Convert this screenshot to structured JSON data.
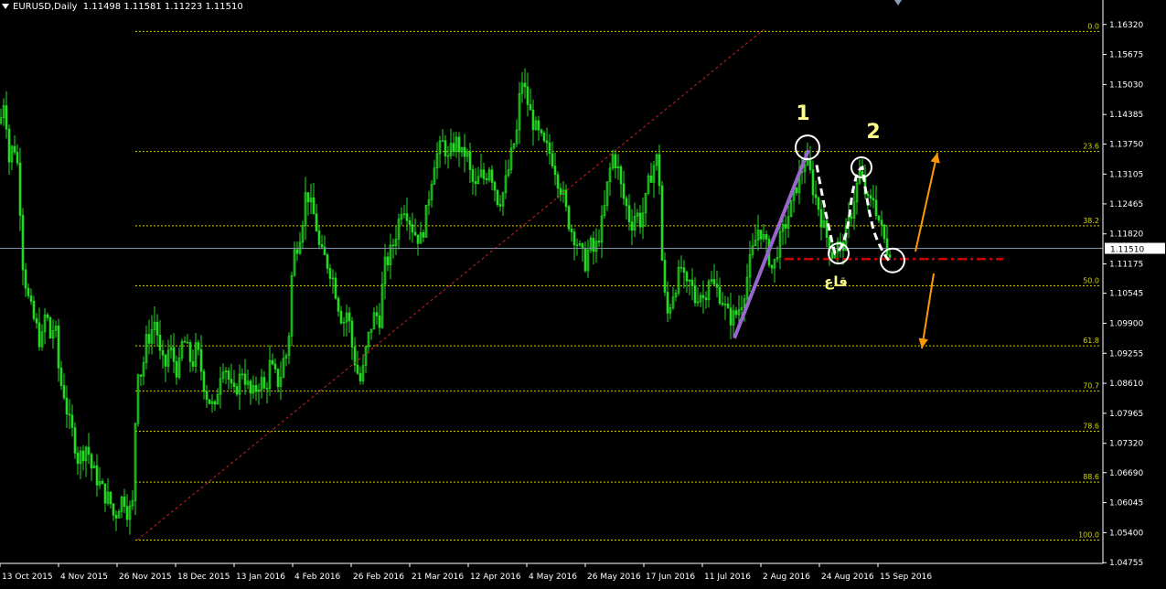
{
  "header": {
    "symbol": "EURUSD,Daily",
    "ohlc": "1.11498 1.11581 1.11223 1.11510"
  },
  "colors": {
    "background": "#000000",
    "candles": "#22dd22",
    "grid_levels": "#d4d400",
    "axis": "#ffffff",
    "trendline": "#cc2222",
    "support_line": "#cc0000",
    "impulse_line": "#9966cc",
    "arrows": "#ff9900",
    "current_price_line": "#7f8f9f"
  },
  "chart_data": {
    "type": "candlestick",
    "y_axis": {
      "min": 1.0474,
      "max": 1.1661,
      "tick_labels": [
        "1.16320",
        "1.15675",
        "1.15030",
        "1.14385",
        "1.13750",
        "1.13105",
        "1.12465",
        "1.11820",
        "1.11175",
        "1.10545",
        "1.09900",
        "1.09255",
        "1.08610",
        "1.07965",
        "1.07320",
        "1.06690",
        "1.06045",
        "1.05400",
        "1.04755"
      ],
      "ticks": [
        1.1632,
        1.15675,
        1.1503,
        1.14385,
        1.1375,
        1.13105,
        1.12465,
        1.1182,
        1.11175,
        1.10545,
        1.099,
        1.09255,
        1.0861,
        1.07965,
        1.0732,
        1.0669,
        1.06045,
        1.054,
        1.04755
      ]
    },
    "x_axis": {
      "tick_labels": [
        "13 Oct 2015",
        "4 Nov 2015",
        "26 Nov 2015",
        "18 Dec 2015",
        "13 Jan 2016",
        "4 Feb 2016",
        "26 Feb 2016",
        "21 Mar 2016",
        "12 Apr 2016",
        "4 May 2016",
        "26 May 2016",
        "17 Jun 2016",
        "11 Jul 2016",
        "2 Aug 2016",
        "24 Aug 2016",
        "15 Sep 2016"
      ]
    },
    "current_price": {
      "label": "1.11510",
      "value": 1.1151
    },
    "fibonacci": {
      "high": 1.1617,
      "low": 1.0524,
      "levels": [
        {
          "label": "0.0",
          "ratio": 0.0
        },
        {
          "label": "23.6",
          "ratio": 0.236
        },
        {
          "label": "38.2",
          "ratio": 0.382
        },
        {
          "label": "50.0",
          "ratio": 0.5
        },
        {
          "label": "61.8",
          "ratio": 0.618
        },
        {
          "label": "70.7",
          "ratio": 0.707
        },
        {
          "label": "78.6",
          "ratio": 0.786
        },
        {
          "label": "88.6",
          "ratio": 0.886
        },
        {
          "label": "100.0",
          "ratio": 1.0
        }
      ]
    },
    "close_path": [
      [
        0,
        1.142
      ],
      [
        5,
        1.148
      ],
      [
        10,
        1.134
      ],
      [
        15,
        1.138
      ],
      [
        20,
        1.132
      ],
      [
        25,
        1.112
      ],
      [
        30,
        1.105
      ],
      [
        35,
        1.101
      ],
      [
        40,
        1.098
      ],
      [
        45,
        1.094
      ],
      [
        50,
        1.102
      ],
      [
        55,
        1.096
      ],
      [
        60,
        1.099
      ],
      [
        65,
        1.087
      ],
      [
        70,
        1.084
      ],
      [
        75,
        1.078
      ],
      [
        80,
        1.075
      ],
      [
        85,
        1.07
      ],
      [
        90,
        1.071
      ],
      [
        95,
        1.073
      ],
      [
        100,
        1.068
      ],
      [
        105,
        1.066
      ],
      [
        110,
        1.064
      ],
      [
        115,
        1.062
      ],
      [
        120,
        1.061
      ],
      [
        125,
        1.057
      ],
      [
        130,
        1.06
      ],
      [
        135,
        1.062
      ],
      [
        140,
        1.058
      ],
      [
        145,
        1.06
      ],
      [
        150,
        1.09
      ],
      [
        155,
        1.088
      ],
      [
        160,
        1.095
      ],
      [
        165,
        1.097
      ],
      [
        170,
        1.1
      ],
      [
        175,
        1.092
      ],
      [
        180,
        1.089
      ],
      [
        185,
        1.094
      ],
      [
        190,
        1.091
      ],
      [
        195,
        1.088
      ],
      [
        200,
        1.096
      ],
      [
        205,
        1.093
      ],
      [
        210,
        1.09
      ],
      [
        215,
        1.094
      ],
      [
        220,
        1.089
      ],
      [
        225,
        1.084
      ],
      [
        230,
        1.082
      ],
      [
        235,
        1.08
      ],
      [
        240,
        1.088
      ],
      [
        245,
        1.091
      ],
      [
        250,
        1.087
      ],
      [
        255,
        1.083
      ],
      [
        260,
        1.086
      ],
      [
        265,
        1.089
      ],
      [
        270,
        1.086
      ],
      [
        275,
        1.083
      ],
      [
        280,
        1.085
      ],
      [
        285,
        1.087
      ],
      [
        290,
        1.084
      ],
      [
        295,
        1.09
      ],
      [
        300,
        1.088
      ],
      [
        305,
        1.086
      ],
      [
        310,
        1.091
      ],
      [
        315,
        1.093
      ],
      [
        320,
        1.113
      ],
      [
        325,
        1.116
      ],
      [
        330,
        1.12
      ],
      [
        335,
        1.128
      ],
      [
        340,
        1.124
      ],
      [
        345,
        1.121
      ],
      [
        350,
        1.114
      ],
      [
        355,
        1.113
      ],
      [
        360,
        1.111
      ],
      [
        365,
        1.108
      ],
      [
        370,
        1.103
      ],
      [
        375,
        1.099
      ],
      [
        380,
        1.102
      ],
      [
        385,
        1.094
      ],
      [
        390,
        1.089
      ],
      [
        395,
        1.086
      ],
      [
        400,
        1.093
      ],
      [
        405,
        1.098
      ],
      [
        410,
        1.101
      ],
      [
        415,
        1.1
      ],
      [
        420,
        1.111
      ],
      [
        425,
        1.113
      ],
      [
        430,
        1.116
      ],
      [
        435,
        1.12
      ],
      [
        440,
        1.125
      ],
      [
        445,
        1.123
      ],
      [
        450,
        1.12
      ],
      [
        455,
        1.118
      ],
      [
        460,
        1.117
      ],
      [
        465,
        1.121
      ],
      [
        470,
        1.128
      ],
      [
        475,
        1.134
      ],
      [
        480,
        1.136
      ],
      [
        485,
        1.138
      ],
      [
        490,
        1.134
      ],
      [
        495,
        1.137
      ],
      [
        500,
        1.138
      ],
      [
        505,
        1.135
      ],
      [
        510,
        1.136
      ],
      [
        515,
        1.13
      ],
      [
        520,
        1.128
      ],
      [
        525,
        1.131
      ],
      [
        530,
        1.13
      ],
      [
        535,
        1.133
      ],
      [
        540,
        1.129
      ],
      [
        545,
        1.125
      ],
      [
        550,
        1.127
      ],
      [
        555,
        1.131
      ],
      [
        560,
        1.136
      ],
      [
        565,
        1.14
      ],
      [
        570,
        1.152
      ],
      [
        575,
        1.148
      ],
      [
        580,
        1.144
      ],
      [
        585,
        1.141
      ],
      [
        590,
        1.139
      ],
      [
        595,
        1.137
      ],
      [
        600,
        1.136
      ],
      [
        605,
        1.134
      ],
      [
        610,
        1.13
      ],
      [
        615,
        1.127
      ],
      [
        620,
        1.122
      ],
      [
        625,
        1.119
      ],
      [
        630,
        1.117
      ],
      [
        635,
        1.114
      ],
      [
        640,
        1.112
      ],
      [
        645,
        1.116
      ],
      [
        650,
        1.114
      ],
      [
        655,
        1.118
      ],
      [
        660,
        1.122
      ],
      [
        665,
        1.13
      ],
      [
        670,
        1.135
      ],
      [
        675,
        1.133
      ],
      [
        680,
        1.127
      ],
      [
        685,
        1.124
      ],
      [
        690,
        1.12
      ],
      [
        695,
        1.123
      ],
      [
        700,
        1.121
      ],
      [
        705,
        1.124
      ],
      [
        710,
        1.13
      ],
      [
        715,
        1.133
      ],
      [
        720,
        1.135
      ],
      [
        725,
        1.107
      ],
      [
        730,
        1.101
      ],
      [
        735,
        1.105
      ],
      [
        740,
        1.108
      ],
      [
        745,
        1.111
      ],
      [
        750,
        1.106
      ],
      [
        755,
        1.108
      ],
      [
        760,
        1.104
      ],
      [
        765,
        1.106
      ],
      [
        770,
        1.104
      ],
      [
        775,
        1.109
      ],
      [
        780,
        1.107
      ],
      [
        785,
        1.106
      ],
      [
        790,
        1.104
      ],
      [
        795,
        1.101
      ],
      [
        800,
        1.1
      ],
      [
        805,
        1.101
      ],
      [
        810,
        1.103
      ],
      [
        815,
        1.107
      ],
      [
        820,
        1.112
      ],
      [
        825,
        1.116
      ],
      [
        830,
        1.12
      ],
      [
        835,
        1.117
      ],
      [
        840,
        1.114
      ],
      [
        845,
        1.11
      ],
      [
        850,
        1.115
      ],
      [
        855,
        1.118
      ],
      [
        860,
        1.121
      ],
      [
        865,
        1.124
      ],
      [
        870,
        1.128
      ],
      [
        875,
        1.131
      ],
      [
        880,
        1.134
      ],
      [
        885,
        1.132
      ],
      [
        890,
        1.127
      ],
      [
        895,
        1.124
      ],
      [
        900,
        1.12
      ],
      [
        905,
        1.117
      ],
      [
        910,
        1.114
      ],
      [
        915,
        1.116
      ],
      [
        920,
        1.115
      ],
      [
        925,
        1.118
      ],
      [
        930,
        1.122
      ],
      [
        935,
        1.127
      ],
      [
        940,
        1.131
      ],
      [
        945,
        1.128
      ],
      [
        950,
        1.124
      ],
      [
        955,
        1.126
      ],
      [
        960,
        1.122
      ],
      [
        965,
        1.118
      ],
      [
        970,
        1.115
      ],
      [
        975,
        1.1151
      ]
    ]
  },
  "annotations": {
    "label_1": "1",
    "label_2": "2",
    "label_bottom": "قاع"
  }
}
